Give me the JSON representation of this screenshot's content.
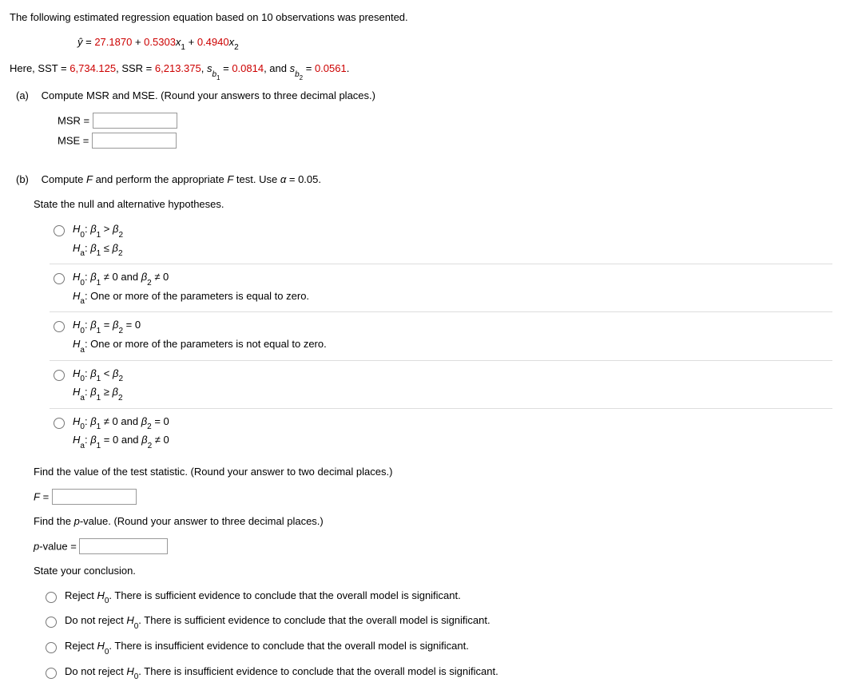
{
  "intro": "The following estimated regression equation based on 10 observations was presented.",
  "equation": {
    "yhat": "ŷ",
    "eq_sign": " = ",
    "const": "27.1870",
    "plus1": " + ",
    "b1": "0.5303",
    "x1": "x",
    "x1_sub": "1",
    "plus2": " + ",
    "b2": "0.4940",
    "x2": "x",
    "x2_sub": "2"
  },
  "given": {
    "prefix": "Here, SST = ",
    "sst": "6,734.125",
    "mid1": ", SSR = ",
    "ssr": "6,213.375",
    "mid2": ", ",
    "sb1_lbl_s": "s",
    "sb1_lbl_b": "b",
    "sb1_lbl_1": "1",
    "eq1": " = ",
    "sb1": "0.0814",
    "mid3": ", and ",
    "sb2_lbl_s": "s",
    "sb2_lbl_b": "b",
    "sb2_lbl_2": "2",
    "eq2": " = ",
    "sb2": "0.0561",
    "end": "."
  },
  "parts": {
    "a": {
      "label": "(a)",
      "text": "Compute MSR and MSE. (Round your answers to three decimal places.)",
      "msr_label": "MSR =",
      "mse_label": "MSE ="
    },
    "b": {
      "label": "(b)",
      "text_pre": "Compute ",
      "F1": "F",
      "text_mid": " and perform the appropriate ",
      "F2": "F",
      "text_post": " test. Use ",
      "alpha": "α",
      "alpha_val": " = 0.05.",
      "state_hyp": "State the null and alternative hypotheses.",
      "find_stat": "Find the value of the test statistic. (Round your answer to two decimal places.)",
      "F_eq": "F",
      "F_eq_sign": " = ",
      "find_pval": "Find the ",
      "pval_ital": "p",
      "find_pval2": "-value. (Round your answer to three decimal places.)",
      "pval_label_p": "p",
      "pval_label_rest": "-value = ",
      "conclusion_label": "State your conclusion."
    }
  },
  "hypotheses": [
    {
      "H0": "H",
      "H0_sub": "0",
      "H0_colon": ": ",
      "H0_b1": "β",
      "H0_b1s": "1",
      "H0_op": " > ",
      "H0_b2": "β",
      "H0_b2s": "2",
      "Ha": "H",
      "Ha_sub": "a",
      "Ha_colon": ": ",
      "Ha_b1": "β",
      "Ha_b1s": "1",
      "Ha_op": " ≤ ",
      "Ha_b2": "β",
      "Ha_b2s": "2"
    },
    {
      "H0": "H",
      "H0_sub": "0",
      "H0_colon": ": ",
      "H0_b1": "β",
      "H0_b1s": "1",
      "H0_op": " ≠ 0 and ",
      "H0_b2": "β",
      "H0_b2s": "2",
      "H0_end": " ≠ 0",
      "Ha": "H",
      "Ha_sub": "a",
      "Ha_text": ": One or more of the parameters is equal to zero."
    },
    {
      "H0": "H",
      "H0_sub": "0",
      "H0_colon": ": ",
      "H0_b1": "β",
      "H0_b1s": "1",
      "H0_op": " = ",
      "H0_b2": "β",
      "H0_b2s": "2",
      "H0_end": " = 0",
      "Ha": "H",
      "Ha_sub": "a",
      "Ha_text": ": One or more of the parameters is not equal to zero."
    },
    {
      "H0": "H",
      "H0_sub": "0",
      "H0_colon": ": ",
      "H0_b1": "β",
      "H0_b1s": "1",
      "H0_op": " < ",
      "H0_b2": "β",
      "H0_b2s": "2",
      "Ha": "H",
      "Ha_sub": "a",
      "Ha_colon": ": ",
      "Ha_b1": "β",
      "Ha_b1s": "1",
      "Ha_op": " ≥ ",
      "Ha_b2": "β",
      "Ha_b2s": "2"
    },
    {
      "H0": "H",
      "H0_sub": "0",
      "H0_colon": ": ",
      "H0_b1": "β",
      "H0_b1s": "1",
      "H0_op": " ≠ 0 and ",
      "H0_b2": "β",
      "H0_b2s": "2",
      "H0_end": " = 0",
      "Ha": "H",
      "Ha_sub": "a",
      "Ha_colon": ": ",
      "Ha_b1": "β",
      "Ha_b1s": "1",
      "Ha_op": " = 0 and ",
      "Ha_b2": "β",
      "Ha_b2s": "2",
      "Ha_end": " ≠ 0"
    }
  ],
  "conclusions": [
    {
      "pre": "Reject ",
      "H": "H",
      "sub": "0",
      "post": ". There is sufficient evidence to conclude that the overall model is significant."
    },
    {
      "pre": "Do not reject ",
      "H": "H",
      "sub": "0",
      "post": ". There is sufficient evidence to conclude that the overall model is significant."
    },
    {
      "pre": "Reject ",
      "H": "H",
      "sub": "0",
      "post": ". There is insufficient evidence to conclude that the overall model is significant."
    },
    {
      "pre": "Do not reject ",
      "H": "H",
      "sub": "0",
      "post": ". There is insufficient evidence to conclude that the overall model is significant."
    }
  ]
}
